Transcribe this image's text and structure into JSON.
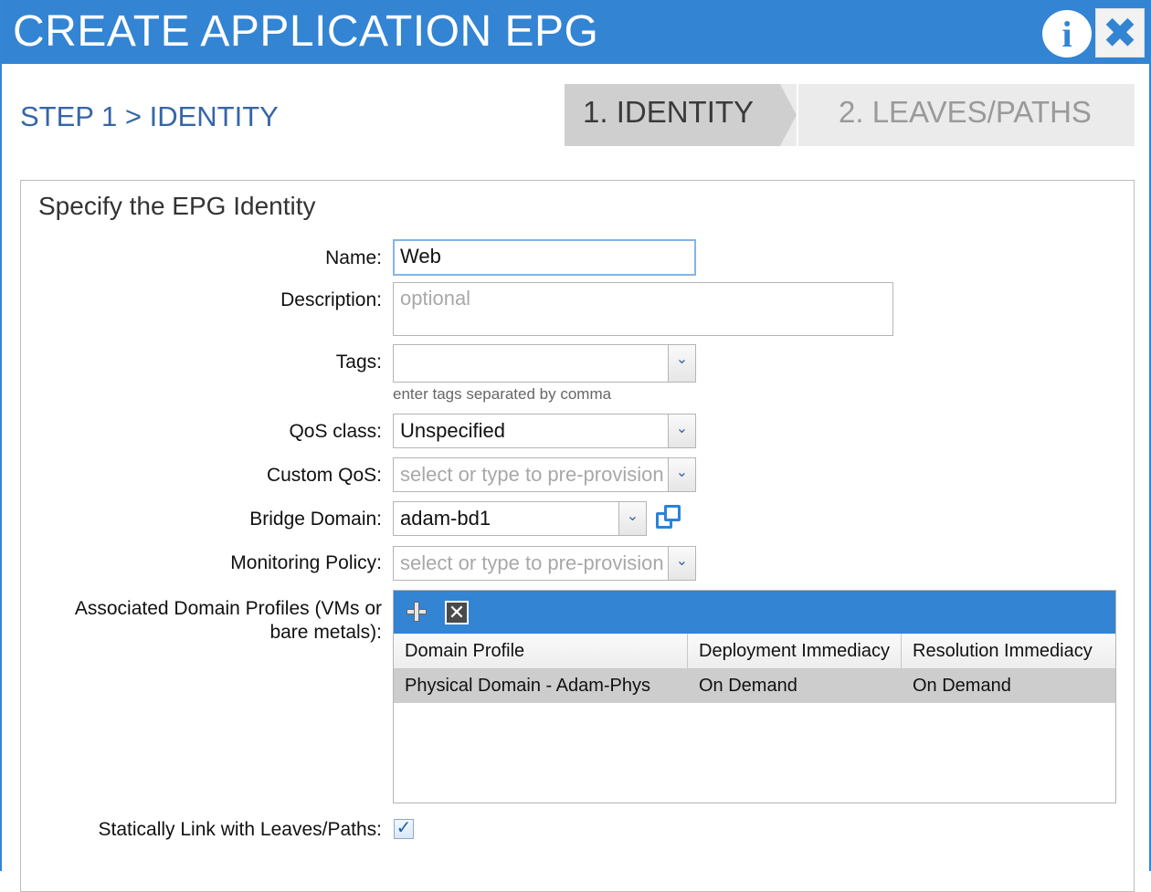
{
  "dialog": {
    "title": "CREATE APPLICATION EPG",
    "info_glyph": "i",
    "close_glyph": "✖",
    "colors": {
      "titlebar": "#3384d3",
      "accent_text": "#3566a8"
    }
  },
  "step": {
    "title": "STEP 1 > IDENTITY"
  },
  "wizard": {
    "steps": [
      {
        "label": "1. IDENTITY",
        "active": true
      },
      {
        "label": "2. LEAVES/PATHS",
        "active": false
      }
    ]
  },
  "form": {
    "heading": "Specify the EPG Identity",
    "name": {
      "label": "Name:",
      "value": "Web"
    },
    "description": {
      "label": "Description:",
      "placeholder": "optional"
    },
    "tags": {
      "label": "Tags:",
      "value": "",
      "hint": "enter tags separated by comma"
    },
    "qos_class": {
      "label": "QoS class:",
      "value": "Unspecified"
    },
    "custom_qos": {
      "label": "Custom QoS:",
      "placeholder": "select or type to pre-provision"
    },
    "bridge_domain": {
      "label": "Bridge Domain:",
      "value": "adam-bd1"
    },
    "monitoring_policy": {
      "label": "Monitoring Policy:",
      "placeholder": "select or type to pre-provision"
    },
    "domain_profiles": {
      "label_line1": "Associated Domain Profiles (VMs or",
      "label_line2": "bare metals):",
      "columns": [
        "Domain Profile",
        "Deployment Immediacy",
        "Resolution Immediacy"
      ],
      "rows": [
        [
          "Physical Domain - Adam-Phys",
          "On Demand",
          "On Demand"
        ]
      ]
    },
    "static_link": {
      "label": "Statically Link with Leaves/Paths:",
      "checked": true,
      "check_glyph": "✓"
    }
  },
  "icons": {
    "dropdown": "chevron-down-icon",
    "dropdown_glyph": "⌄",
    "add": "plus-icon",
    "delete": "delete-icon",
    "delete_glyph": "✕",
    "open": "open-external-icon"
  }
}
